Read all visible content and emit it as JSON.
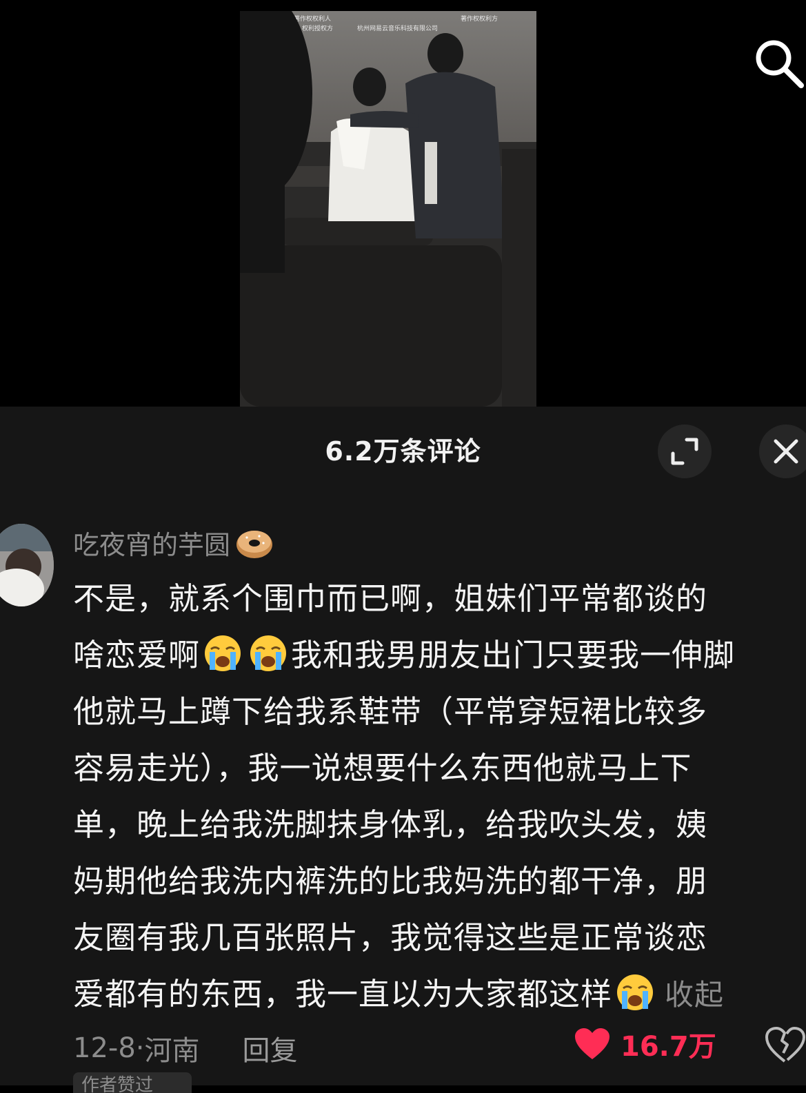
{
  "header": {
    "comment_count_title": "6.2万条评论"
  },
  "video": {
    "overlay_text": [
      "著作权权利人",
      "权利授权方",
      "杭州网易云音乐科技有限公司",
      "著作权权利方",
      "授权方"
    ]
  },
  "comment": {
    "username": "吃夜宵的芋圆",
    "username_emoji": "bagel-emoji",
    "lines": [
      "不是，就系个围巾而已啊，姐妹们平常都谈的",
      "啥恋爱啊",
      "我和我男朋友出门只要我一伸脚",
      "他就马上蹲下给我系鞋带（平常穿短裙比较多",
      "容易走光），我一说想要什么东西他就马上下",
      "单，晚上给我洗脚抹身体乳，给我吹头发，姨",
      "妈期他给我洗内裤洗的比我妈洗的都干净，朋",
      "友圈有我几百张照片，我觉得这些是正常谈恋",
      "爱都有的东西，我一直以为大家都这样"
    ],
    "collapse_label": "收起",
    "date": "12-8",
    "location": "河南",
    "reply_label": "回复",
    "like_count": "16.7万",
    "author_tag": "作者赞过"
  },
  "colors": {
    "sheet_bg": "#161616",
    "like_red": "#ff2d55",
    "muted_text": "#8c8c8c"
  }
}
